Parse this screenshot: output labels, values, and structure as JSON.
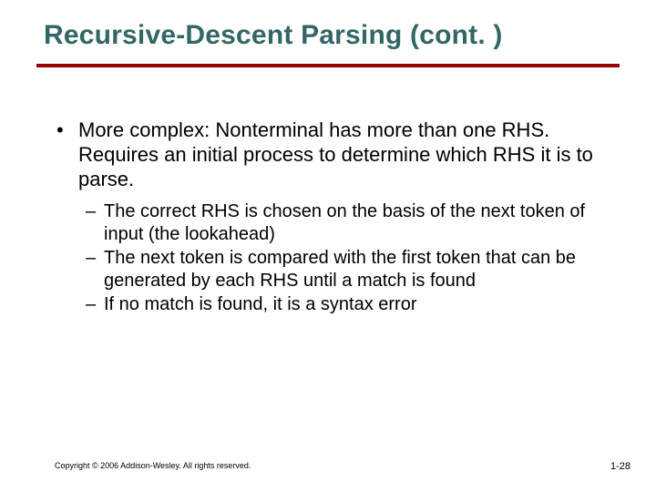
{
  "title": "Recursive-Descent Parsing (cont. )",
  "bullets": [
    {
      "text": "More complex: Nonterminal has more than one RHS.   Requires an initial process to determine which RHS it is to parse.",
      "sub": [
        "The correct RHS is chosen on the basis of the next token of input (the lookahead)",
        "The next token is compared with the first token that can be generated by each RHS until a match is found",
        "If no match is found, it is a syntax error"
      ]
    }
  ],
  "footer": {
    "copyright": "Copyright © 2006 Addison-Wesley. All rights reserved.",
    "page": "1-28"
  }
}
